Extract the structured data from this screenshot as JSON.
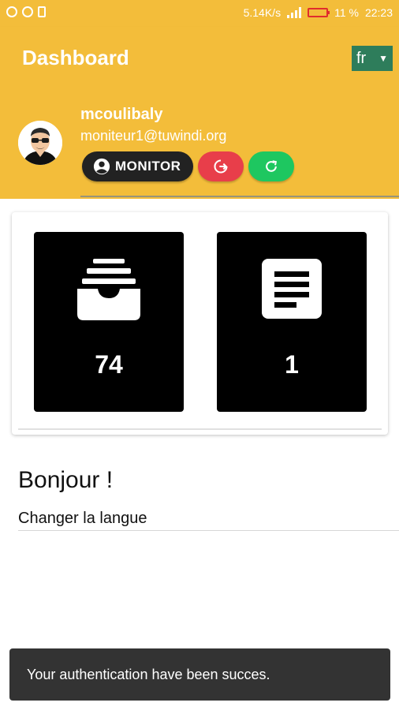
{
  "status_bar": {
    "network_speed": "5.14K/s",
    "battery_percent": "11 %",
    "time": "22:23"
  },
  "app_bar": {
    "title": "Dashboard",
    "language": "fr"
  },
  "profile": {
    "username": "mcoulibaly",
    "email": "moniteur1@tuwindi.org",
    "role_button_label": "MONITOR"
  },
  "tiles": [
    {
      "icon": "inbox-archive-icon",
      "count": "74"
    },
    {
      "icon": "document-icon",
      "count": "1"
    }
  ],
  "greeting": "Bonjour !",
  "change_language_label": "Changer la langue",
  "snackbar": {
    "message": "Your authentication have been succes."
  },
  "colors": {
    "primary": "#f3bd3a",
    "logout_button": "#e83e4a",
    "refresh_button": "#1ec760",
    "language_select": "#2e7d5b"
  }
}
